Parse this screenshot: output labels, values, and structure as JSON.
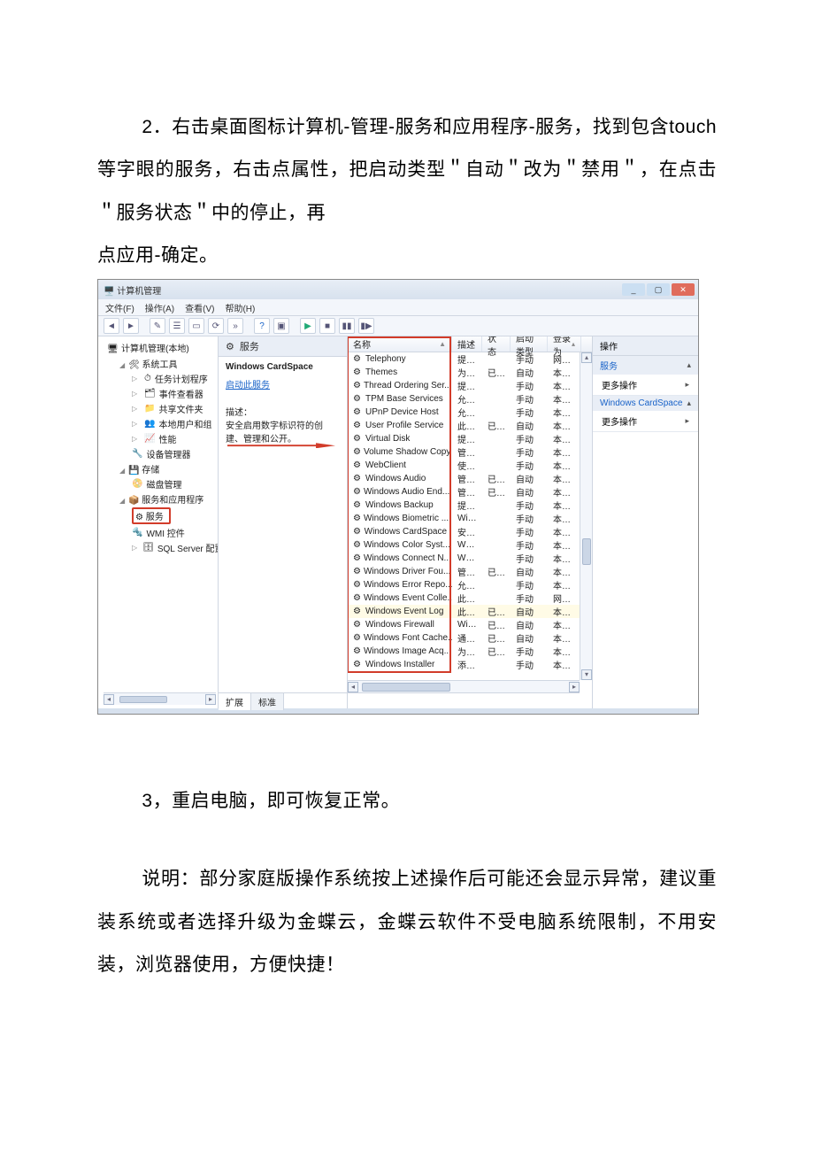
{
  "doc": {
    "p1_a": "2．右击桌面图标计算机-管理-服务和应用程序-服务，找到包含touch 等字眼的服务，右击点属性，把启动类型＂自动＂改为＂禁用＂，在点击＂服务状态＂中的停止，再",
    "p1_b": "点应用-确定。",
    "p2": "3，重启电脑，即可恢复正常。",
    "p3": "说明：部分家庭版操作系统按上述操作后可能还会显示异常，建议重装系统或者选择升级为金蝶云，金蝶云软件不受电脑系统限制，不用安装，浏览器使用，方便快捷！"
  },
  "win": {
    "title": "计算机管理",
    "menu": {
      "file": "文件(F)",
      "action": "操作(A)",
      "view": "查看(V)",
      "help": "帮助(H)"
    }
  },
  "tree": {
    "root": "计算机管理(本地)",
    "systools": "系统工具",
    "sched": "任务计划程序",
    "eventv": "事件查看器",
    "shared": "共享文件夹",
    "users": "本地用户和组",
    "perf": "性能",
    "devmgr": "设备管理器",
    "storage": "存储",
    "diskmgr": "磁盘管理",
    "svcapps": "服务和应用程序",
    "services": "服务",
    "wmi": "WMI 控件",
    "sql": "SQL Server 配置管理"
  },
  "mid": {
    "header": "服务",
    "selected": "Windows CardSpace",
    "start_link": "启动此服务",
    "desc_label": "描述：",
    "desc_text": "安全启用数字标识符的创建、管理和公开。",
    "tab_ext": "扩展",
    "tab_std": "标准"
  },
  "table": {
    "cols": {
      "name": "名称",
      "desc": "描述",
      "status": "状态",
      "type": "启动类型",
      "logon": "登录为"
    },
    "rows": [
      {
        "name": "Telephony",
        "desc": "提供...",
        "status": "",
        "type": "手动",
        "logon": "网络服"
      },
      {
        "name": "Themes",
        "desc": "为用...",
        "status": "已启动",
        "type": "自动",
        "logon": "本地系"
      },
      {
        "name": "Thread Ordering Ser...",
        "desc": "提供...",
        "status": "",
        "type": "手动",
        "logon": "本地服"
      },
      {
        "name": "TPM Base Services",
        "desc": "允许...",
        "status": "",
        "type": "手动",
        "logon": "本地服"
      },
      {
        "name": "UPnP Device Host",
        "desc": "允许 ...",
        "status": "",
        "type": "手动",
        "logon": "本地服"
      },
      {
        "name": "User Profile Service",
        "desc": "此服...",
        "status": "已启动",
        "type": "自动",
        "logon": "本地系"
      },
      {
        "name": "Virtual Disk",
        "desc": "提供...",
        "status": "",
        "type": "手动",
        "logon": "本地系"
      },
      {
        "name": "Volume Shadow Copy",
        "desc": "管理...",
        "status": "",
        "type": "手动",
        "logon": "本地系"
      },
      {
        "name": "WebClient",
        "desc": "使基...",
        "status": "",
        "type": "手动",
        "logon": "本地服"
      },
      {
        "name": "Windows Audio",
        "desc": "管理...",
        "status": "已启动",
        "type": "自动",
        "logon": "本地服"
      },
      {
        "name": "Windows Audio End...",
        "desc": "管理 ...",
        "status": "已启动",
        "type": "自动",
        "logon": "本地系"
      },
      {
        "name": "Windows Backup",
        "desc": "提供 ...",
        "status": "",
        "type": "手动",
        "logon": "本地系"
      },
      {
        "name": "Windows Biometric ...",
        "desc": "Win...",
        "status": "",
        "type": "手动",
        "logon": "本地系"
      },
      {
        "name": "Windows CardSpace",
        "desc": "安全...",
        "status": "",
        "type": "手动",
        "logon": "本地系"
      },
      {
        "name": "Windows Color Syst...",
        "desc": "Wcs...",
        "status": "",
        "type": "手动",
        "logon": "本地服"
      },
      {
        "name": "Windows Connect N...",
        "desc": "WC...",
        "status": "",
        "type": "手动",
        "logon": "本地服"
      },
      {
        "name": "Windows Driver Fou...",
        "desc": "管理...",
        "status": "已启动",
        "type": "自动",
        "logon": "本地系"
      },
      {
        "name": "Windows Error Repo...",
        "desc": "允许...",
        "status": "",
        "type": "手动",
        "logon": "本地系"
      },
      {
        "name": "Windows Event Colle...",
        "desc": "此服...",
        "status": "",
        "type": "手动",
        "logon": "网络服"
      },
      {
        "name": "Windows Event Log",
        "desc": "此服...",
        "status": "已启动",
        "type": "自动",
        "logon": "本地服",
        "hl": true
      },
      {
        "name": "Windows Firewall",
        "desc": "Win...",
        "status": "已启动",
        "type": "自动",
        "logon": "本地服"
      },
      {
        "name": "Windows Font Cache...",
        "desc": "通过...",
        "status": "已启动",
        "type": "自动",
        "logon": "本地服"
      },
      {
        "name": "Windows Image Acq...",
        "desc": "为扫...",
        "status": "已启动",
        "type": "手动",
        "logon": "本地服"
      },
      {
        "name": "Windows Installer",
        "desc": "添加...",
        "status": "",
        "type": "手动",
        "logon": "本地系"
      }
    ]
  },
  "actions": {
    "header": "操作",
    "svc_title": "服务",
    "more1": "更多操作",
    "sel_title": "Windows CardSpace",
    "more2": "更多操作"
  }
}
